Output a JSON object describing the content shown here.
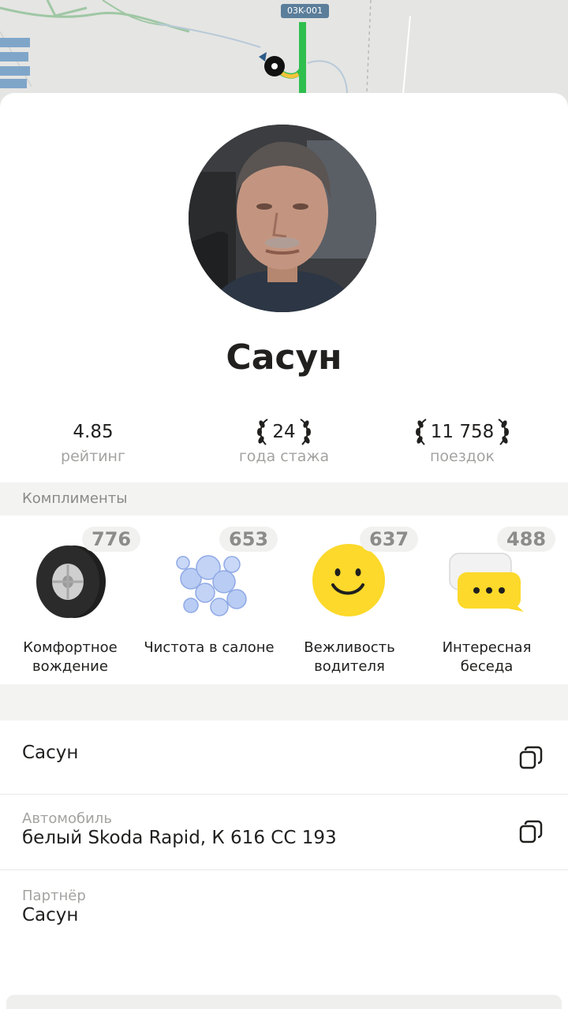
{
  "map": {
    "route_label": "03K-001"
  },
  "driver": {
    "name": "Сасун"
  },
  "stats": [
    {
      "value": "4.85",
      "label": "рейтинг",
      "laurel": false
    },
    {
      "value": "24",
      "label": "года стажа",
      "laurel": true
    },
    {
      "value": "11 758",
      "label": "поездок",
      "laurel": true
    }
  ],
  "compliments": {
    "title": "Комплименты",
    "items": [
      {
        "count": "776",
        "label": "Комфортное вождение",
        "icon": "wheel-icon"
      },
      {
        "count": "653",
        "label": "Чистота в салоне",
        "icon": "bubbles-icon"
      },
      {
        "count": "637",
        "label": "Вежливость водителя",
        "icon": "smiley-icon"
      },
      {
        "count": "488",
        "label": "Интересная беседа",
        "icon": "chat-bubble-icon"
      }
    ]
  },
  "info": {
    "name_row": {
      "value": "Сасун"
    },
    "car_row": {
      "label": "Автомобиль",
      "value": "белый Skoda Rapid, К 616 СС 193"
    },
    "partner_row": {
      "label": "Партнёр",
      "value": "Сасун"
    }
  },
  "colors": {
    "accent_yellow": "#fcd92a",
    "route_green": "#2fbf4f",
    "muted_text": "#a3a3a1"
  }
}
